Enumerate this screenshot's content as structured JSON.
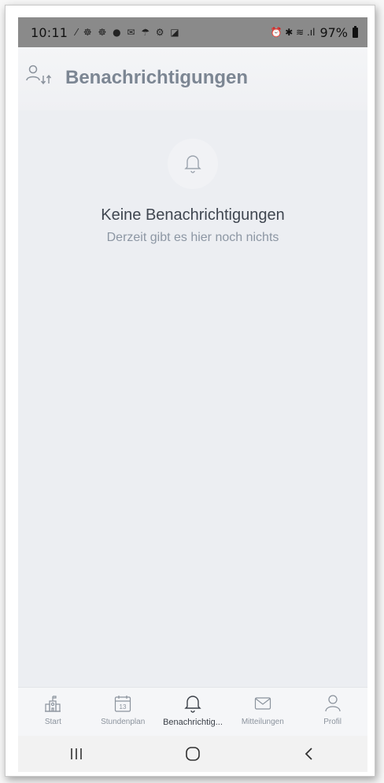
{
  "status_bar": {
    "time": "10:11",
    "notification_icons": "⁄ ☸ ☸ ● ✉ ☂ ⚙ ◪",
    "right_icons": "⏰ ✱ ≋ .ıl",
    "battery_percent": "97%"
  },
  "header": {
    "title": "Benachrichtigungen",
    "icon": "user-switch-icon"
  },
  "empty_state": {
    "icon": "bell-icon",
    "title": "Keine Benachrichtigungen",
    "subtitle": "Derzeit gibt es hier noch nichts"
  },
  "tabs": [
    {
      "label": "Start",
      "icon": "school-icon",
      "active": false
    },
    {
      "label": "Stundenplan",
      "icon": "calendar-icon",
      "calendar_day": "13",
      "active": false
    },
    {
      "label": "Benachrichtig...",
      "icon": "bell-icon",
      "active": true
    },
    {
      "label": "Mitteilungen",
      "icon": "mail-icon",
      "active": false
    },
    {
      "label": "Profil",
      "icon": "person-icon",
      "active": false
    }
  ],
  "system_nav": {
    "recents": "recents-icon",
    "home": "home-icon",
    "back": "back-icon"
  },
  "colors": {
    "background": "#eceef2",
    "title": "#7c8693",
    "active_tab": "#3b4048",
    "inactive_tab": "#8b939d",
    "status_bar": "#8a8a8a"
  }
}
